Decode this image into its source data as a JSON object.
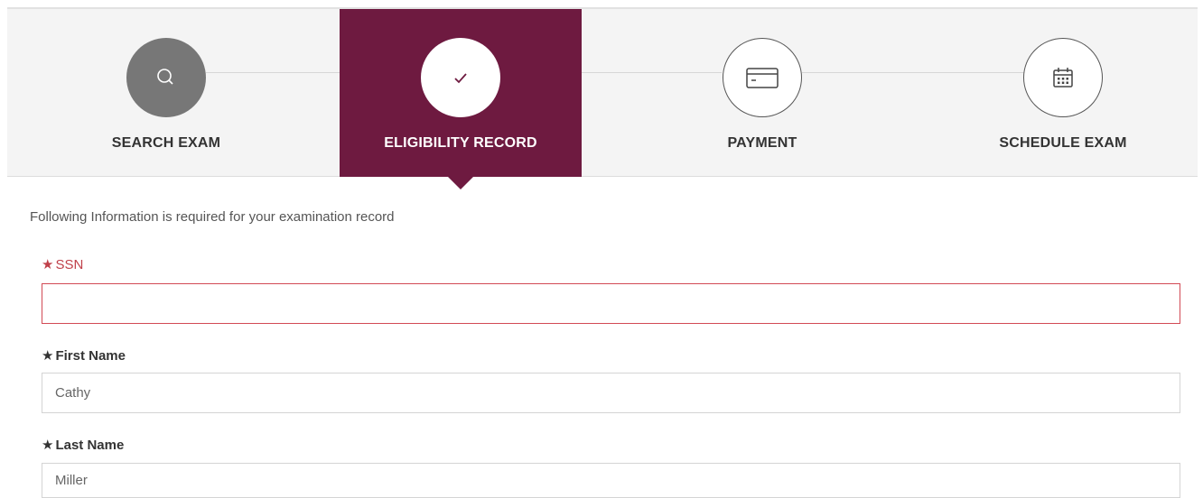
{
  "stepper": {
    "steps": [
      {
        "label": "SEARCH EXAM",
        "icon": "search-icon",
        "state": "completed"
      },
      {
        "label": "ELIGIBILITY RECORD",
        "icon": "checkmark-icon",
        "state": "active"
      },
      {
        "label": "PAYMENT",
        "icon": "credit-card-icon",
        "state": "upcoming"
      },
      {
        "label": "SCHEDULE EXAM",
        "icon": "calendar-icon",
        "state": "upcoming"
      }
    ],
    "active_color": "#6e1a40"
  },
  "form": {
    "intro": "Following Information is required for your examination record",
    "required_mark": "★",
    "fields": [
      {
        "label": "SSN",
        "value": "",
        "state": "error"
      },
      {
        "label": "First Name",
        "value": "Cathy",
        "state": "normal"
      },
      {
        "label": "Last Name",
        "value": "Miller",
        "state": "normal"
      }
    ],
    "error_color": "#c0404a"
  }
}
